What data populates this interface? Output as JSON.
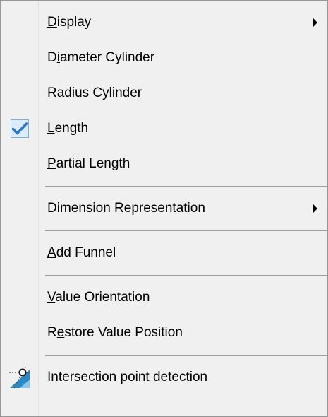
{
  "menu": {
    "items": [
      {
        "pre": "",
        "mn": "D",
        "post": "isplay",
        "has_submenu": true
      },
      {
        "pre": "D",
        "mn": "i",
        "post": "ameter Cylinder",
        "has_submenu": false
      },
      {
        "pre": "",
        "mn": "R",
        "post": "adius Cylinder",
        "has_submenu": false
      },
      {
        "pre": "",
        "mn": "L",
        "post": "ength",
        "has_submenu": false,
        "checked": true
      },
      {
        "pre": "",
        "mn": "P",
        "post": "artial Length",
        "has_submenu": false
      },
      {
        "pre": "Di",
        "mn": "m",
        "post": "ension Representation",
        "has_submenu": true
      },
      {
        "pre": "",
        "mn": "A",
        "post": "dd Funnel",
        "has_submenu": false
      },
      {
        "pre": "",
        "mn": "V",
        "post": "alue Orientation",
        "has_submenu": false
      },
      {
        "pre": "R",
        "mn": "e",
        "post": "store Value Position",
        "has_submenu": false
      },
      {
        "pre": "",
        "mn": "I",
        "post": "ntersection point detection",
        "has_submenu": false,
        "icon": "intersection-point-icon"
      }
    ]
  },
  "colors": {
    "menu_background": "#f0f0f0",
    "check_mark": "#2d79c7",
    "check_background": "#dcecfc",
    "separator": "#a0a0a0",
    "text": "#000000"
  }
}
